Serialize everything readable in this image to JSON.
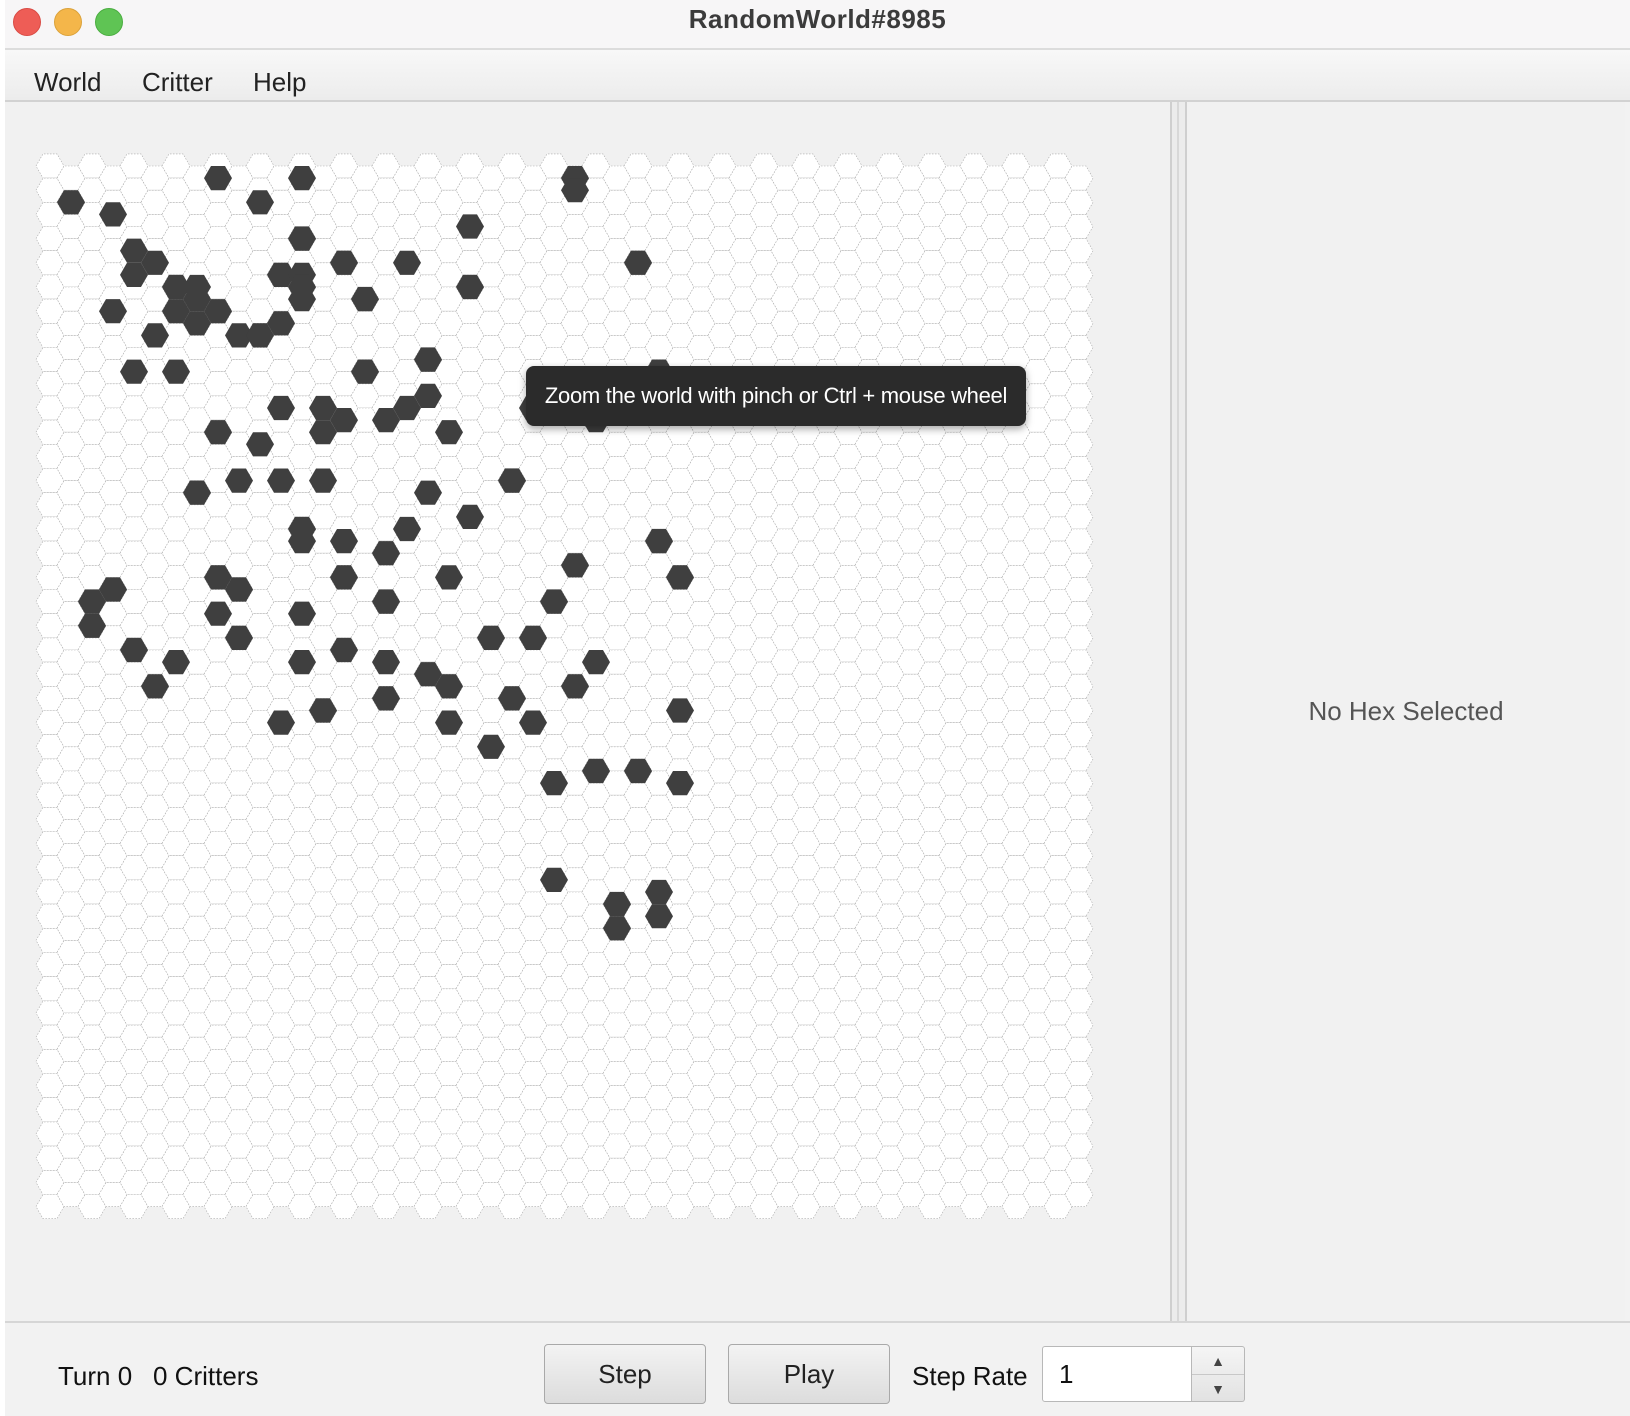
{
  "window": {
    "title": "RandomWorld#8985"
  },
  "menubar": {
    "items": [
      {
        "label": "World"
      },
      {
        "label": "Critter"
      },
      {
        "label": "Help"
      }
    ]
  },
  "world": {
    "columns": 31,
    "rows": 44,
    "empty_hex_color": "#ffffff",
    "occupied_hex_color": "#3f3f3f",
    "tooltip": "Zoom the world with pinch or Ctrl + mouse wheel",
    "occupied_hexes": [
      [
        1,
        3
      ],
      [
        3,
        4
      ],
      [
        3,
        12
      ],
      [
        2,
        36
      ],
      [
        3,
        35
      ],
      [
        2,
        38
      ],
      [
        4,
        9
      ],
      [
        4,
        7
      ],
      [
        4,
        17
      ],
      [
        4,
        40
      ],
      [
        5,
        8
      ],
      [
        5,
        14
      ],
      [
        5,
        43
      ],
      [
        6,
        10
      ],
      [
        6,
        12
      ],
      [
        6,
        17
      ],
      [
        6,
        41
      ],
      [
        7,
        10
      ],
      [
        7,
        11
      ],
      [
        7,
        13
      ],
      [
        7,
        27
      ],
      [
        8,
        1
      ],
      [
        8,
        12
      ],
      [
        8,
        22
      ],
      [
        8,
        34
      ],
      [
        8,
        37
      ],
      [
        9,
        14
      ],
      [
        9,
        26
      ],
      [
        9,
        35
      ],
      [
        9,
        39
      ],
      [
        10,
        3
      ],
      [
        10,
        14
      ],
      [
        10,
        23
      ],
      [
        11,
        9
      ],
      [
        11,
        13
      ],
      [
        11,
        20
      ],
      [
        11,
        26
      ],
      [
        11,
        46
      ],
      [
        12,
        1
      ],
      [
        12,
        6
      ],
      [
        12,
        9
      ],
      [
        12,
        10
      ],
      [
        12,
        11
      ],
      [
        12,
        30
      ],
      [
        12,
        31
      ],
      [
        12,
        37
      ],
      [
        12,
        41
      ],
      [
        13,
        20
      ],
      [
        13,
        22
      ],
      [
        13,
        26
      ],
      [
        13,
        45
      ],
      [
        14,
        8
      ],
      [
        14,
        21
      ],
      [
        14,
        31
      ],
      [
        14,
        34
      ],
      [
        14,
        40
      ],
      [
        15,
        11
      ],
      [
        15,
        17
      ],
      [
        16,
        21
      ],
      [
        16,
        41
      ],
      [
        16,
        32
      ],
      [
        16,
        36
      ],
      [
        16,
        44
      ],
      [
        17,
        8
      ],
      [
        17,
        20
      ],
      [
        17,
        30
      ],
      [
        18,
        16
      ],
      [
        18,
        19
      ],
      [
        18,
        27
      ],
      [
        18,
        42
      ],
      [
        19,
        43
      ],
      [
        19,
        22
      ],
      [
        19,
        34
      ],
      [
        19,
        46
      ],
      [
        20,
        10
      ],
      [
        20,
        5
      ],
      [
        20,
        29
      ],
      [
        21,
        39
      ],
      [
        21,
        48
      ],
      [
        22,
        26
      ],
      [
        22,
        44
      ],
      [
        23,
        20
      ],
      [
        23,
        39
      ],
      [
        23,
        46
      ],
      [
        24,
        36
      ],
      [
        24,
        51
      ],
      [
        24,
        59
      ],
      [
        25,
        1
      ],
      [
        25,
        2
      ],
      [
        25,
        33
      ],
      [
        25,
        43
      ],
      [
        26,
        21
      ],
      [
        26,
        41
      ],
      [
        26,
        50
      ],
      [
        27,
        61
      ],
      [
        27,
        63
      ],
      [
        28,
        50
      ],
      [
        28,
        8
      ],
      [
        29,
        31
      ],
      [
        29,
        17
      ],
      [
        29,
        62
      ],
      [
        29,
        60
      ],
      [
        30,
        51
      ],
      [
        30,
        45
      ],
      [
        30,
        34
      ]
    ]
  },
  "info_panel": {
    "message": "No Hex Selected"
  },
  "status": {
    "turn": "Turn 0",
    "critters": "0 Critters",
    "step_label": "Step",
    "play_label": "Play",
    "step_rate_label": "Step Rate",
    "step_rate_value": "1"
  }
}
